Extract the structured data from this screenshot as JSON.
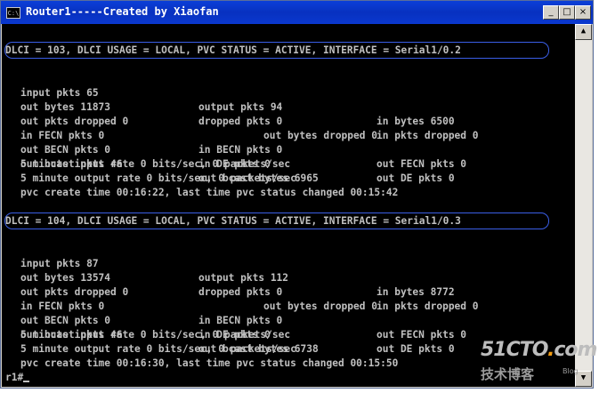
{
  "window": {
    "title": "Router1-----Created by Xiaofan",
    "icon_text": "C:\\",
    "minimize_glyph": "_",
    "maximize_glyph": "□",
    "close_glyph": "×"
  },
  "scrollbar": {
    "up_glyph": "▲",
    "down_glyph": "▼"
  },
  "blocks": [
    {
      "header": "DLCI = 103, DLCI USAGE = LOCAL, PVC STATUS = ACTIVE, INTERFACE = Serial1/0.2",
      "r1": [
        "input pkts 65",
        "output pkts 94",
        "in bytes 6500"
      ],
      "r2": [
        "out bytes 11873",
        "dropped pkts 0",
        "in pkts dropped 0"
      ],
      "r3": [
        "out pkts dropped 0",
        "out bytes dropped 0"
      ],
      "r4": [
        "in FECN pkts 0",
        "in BECN pkts 0",
        "out FECN pkts 0"
      ],
      "r5": [
        "out BECN pkts 0",
        "in DE pkts 0",
        "out DE pkts 0"
      ],
      "r6": [
        "out bcast pkts 46",
        "out bcast bytes 6965"
      ],
      "in_rate": "5 minute input rate 0 bits/sec, 0 packets/sec",
      "out_rate": "5 minute output rate 0 bits/sec, 0 packets/sec",
      "pvc": "pvc create time 00:16:22, last time pvc status changed 00:15:42"
    },
    {
      "header": "DLCI = 104, DLCI USAGE = LOCAL, PVC STATUS = ACTIVE, INTERFACE = Serial1/0.3",
      "r1": [
        "input pkts 87",
        "output pkts 112",
        "in bytes 8772"
      ],
      "r2": [
        "out bytes 13574",
        "dropped pkts 0",
        "in pkts dropped 0"
      ],
      "r3": [
        "out pkts dropped 0",
        "out bytes dropped 0"
      ],
      "r4": [
        "in FECN pkts 0",
        "in BECN pkts 0",
        "out FECN pkts 0"
      ],
      "r5": [
        "out BECN pkts 0",
        "in DE pkts 0",
        "out DE pkts 0"
      ],
      "r6": [
        "out bcast pkts 46",
        "out bcast bytes 6738"
      ],
      "in_rate": "5 minute input rate 0 bits/sec, 0 packets/sec",
      "out_rate": "5 minute output rate 0 bits/sec, 0 packets/sec",
      "pvc": "pvc create time 00:16:30, last time pvc status changed 00:15:50"
    }
  ],
  "prompt": "r1#",
  "watermark": {
    "site": "51CTO",
    "dot": ".",
    "tld": "com",
    "subtitle": "技术博客",
    "blog": "Blog"
  },
  "colors": {
    "console_bg": "#000000",
    "console_fg": "#c0c0c0",
    "titlebar": "#0a3ed6",
    "highlight": "#3a5ee6"
  }
}
